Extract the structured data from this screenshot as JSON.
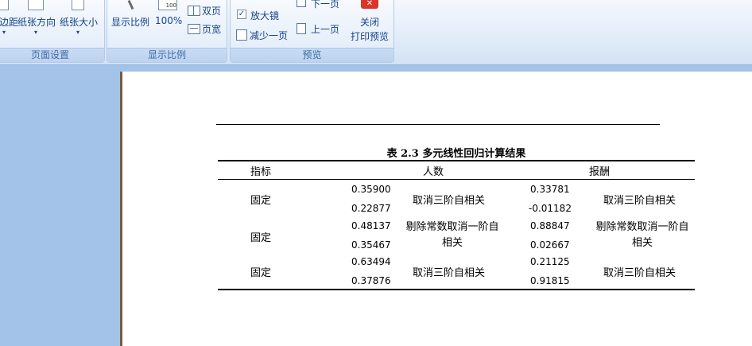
{
  "ribbon": {
    "page_setup": {
      "margins_label": "边距",
      "orientation_label": "纸张方向",
      "size_label": "纸张大小",
      "group_label": "页面设置"
    },
    "zoom": {
      "zoom_label": "显示比例",
      "hundred_label": "100%",
      "two_pages_label": "双页",
      "page_width_label": "页宽",
      "group_label": "显示比例"
    },
    "preview": {
      "magnifier_label": "放大镜",
      "magnifier_checked": true,
      "shrink_label": "减少一页",
      "next_label": "下一页",
      "prev_label": "上一页",
      "close_line1": "关闭",
      "close_line2": "打印预览",
      "group_label": "预览"
    }
  },
  "document": {
    "table_title": "表 2.3 多元线性回归计算结果",
    "headers": [
      "指标",
      "人数",
      "报酬"
    ],
    "rows": [
      {
        "indicator": "固定",
        "a1": "0.35900",
        "a2": "0.22877",
        "a_note": "取消三阶自相关",
        "b1": "0.33781",
        "b2": "-0.01182",
        "b_note": "取消三阶自相关"
      },
      {
        "indicator": "固定",
        "a1": "0.48137",
        "a2": "0.35467",
        "a_note": "剔除常数取消一阶自相关",
        "b1": "0.88847",
        "b2": "0.02667",
        "b_note": "剔除常数取消一阶自相关"
      },
      {
        "indicator": "固定",
        "a1": "0.63494",
        "a2": "0.37876",
        "a_note": "取消三阶自相关",
        "b1": "0.21125",
        "b2": "0.91815",
        "b_note": "取消三阶自相关"
      }
    ]
  },
  "colors": {
    "ribbon_text": "#15428b",
    "workspace": "#a4c3e8",
    "close_red": "#d9352b"
  }
}
